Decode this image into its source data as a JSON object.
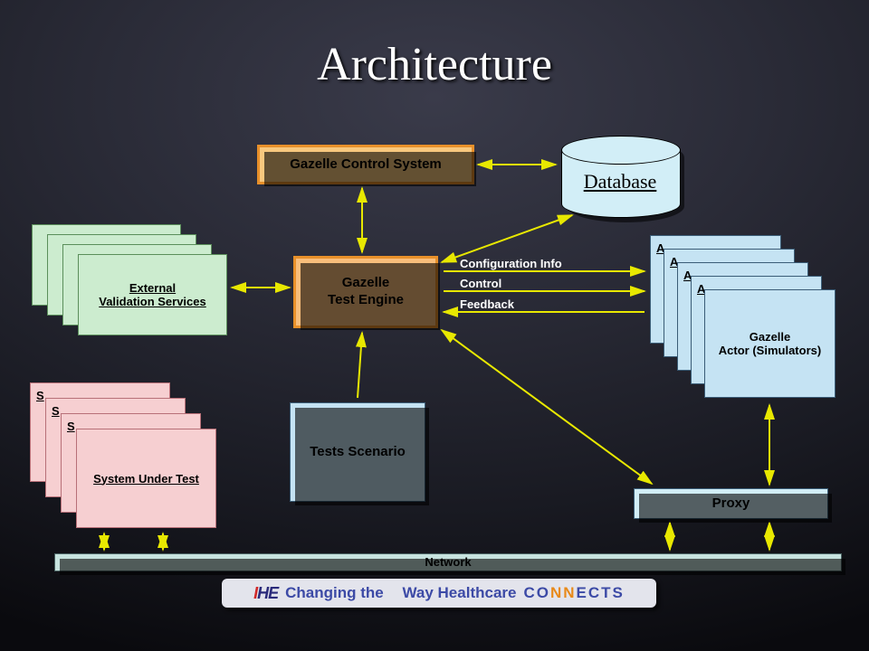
{
  "title": "Architecture",
  "nodes": {
    "control_system": "Gazelle Control System",
    "test_engine": "Gazelle\nTest Engine",
    "database": "Database",
    "external_validation": "External\nValidation Services",
    "system_under_test": "System Under Test",
    "tests_scenario": "Tests Scenario",
    "actor_simulators": "Gazelle\nActor (Simulators)",
    "proxy": "Proxy",
    "network": "Network"
  },
  "edge_labels": {
    "config_info": "Configuration Info",
    "control": "Control",
    "feedback": "Feedback"
  },
  "stack_glyphs": {
    "sut_s": "S",
    "actor_a": "A"
  },
  "footer": {
    "logo_i": "I",
    "logo_rest": "HE",
    "part1": "Changing the",
    "part2": "Way Healthcare",
    "co": "CO",
    "nn": "NN",
    "ects": "ECTS"
  }
}
